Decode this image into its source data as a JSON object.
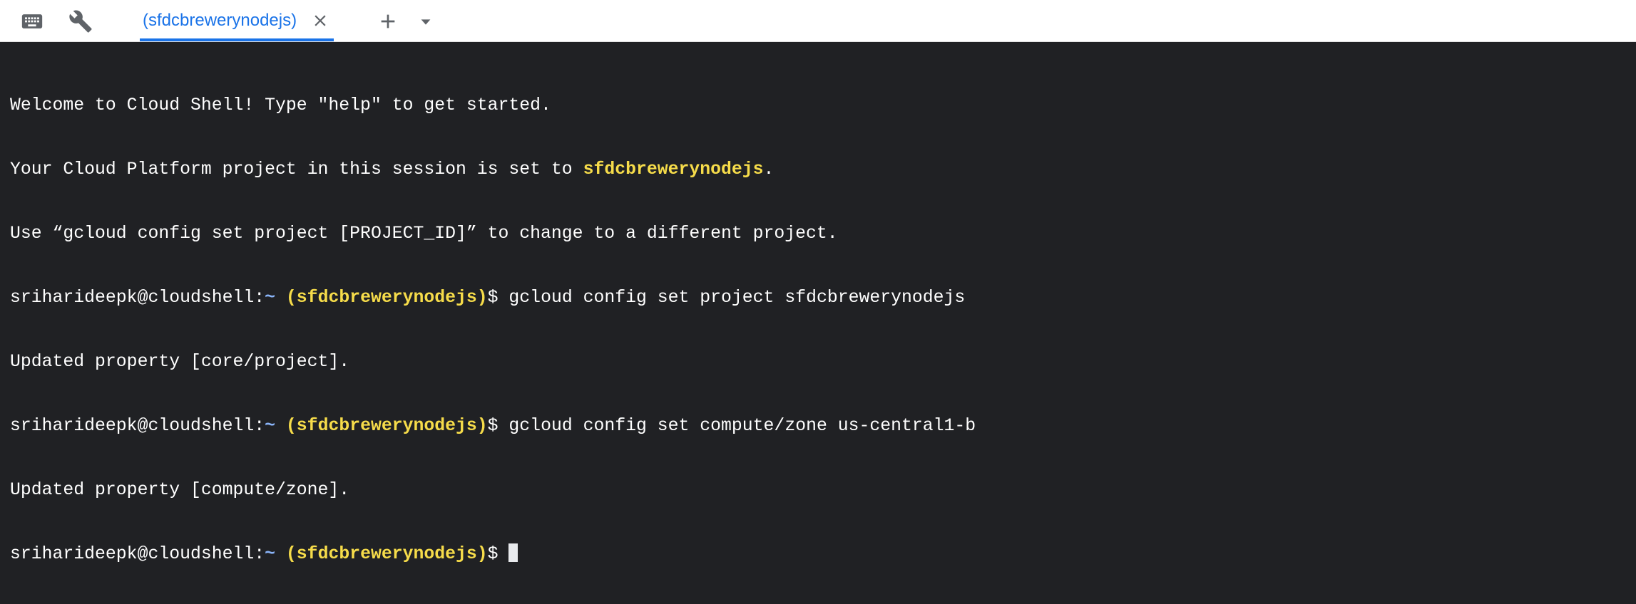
{
  "tabbar": {
    "tab_label": "(sfdcbrewerynodejs)",
    "icons": [
      "keyboard-icon",
      "wrench-icon",
      "close-icon",
      "add-icon",
      "chevron-down-icon"
    ]
  },
  "terminal": {
    "welcome": "Welcome to Cloud Shell! Type \"help\" to get started.",
    "project_prefix": "Your Cloud Platform project in this session is set to ",
    "project_name": "sfdcbrewerynodejs",
    "project_suffix": ".",
    "use_hint": "Use “gcloud config set project [PROJECT_ID]” to change to a different project.",
    "prompt_user": "sriharideepk@cloudshell:",
    "prompt_tilde": "~",
    "prompt_project": "(sfdcbrewerynodejs)",
    "prompt_dollar": "$ ",
    "cmd1": "gcloud config set project sfdcbrewerynodejs",
    "out1": "Updated property [core/project].",
    "cmd2": "gcloud config set compute/zone us-central1-b",
    "out2": "Updated property [compute/zone]."
  },
  "colors": {
    "accent": "#1a73e8",
    "terminal_bg": "#202124",
    "highlight": "#f6dc4a",
    "tilde": "#8ab4f8"
  }
}
